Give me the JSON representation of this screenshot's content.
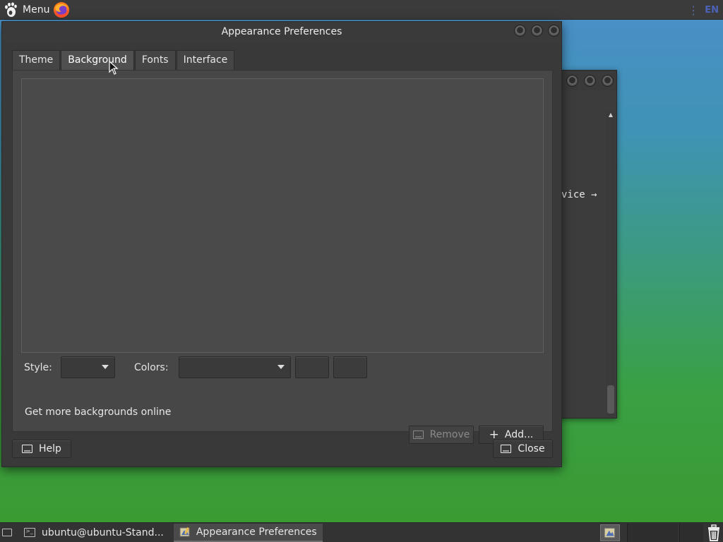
{
  "top_panel": {
    "menu_label": "Menu",
    "icons": [
      "gnome-foot-icon",
      "firefox-icon"
    ],
    "lang": "EN"
  },
  "background_window": {
    "text": "vice →"
  },
  "window": {
    "title": "Appearance Preferences",
    "tabs": [
      {
        "label": "Theme",
        "active": false
      },
      {
        "label": "Background",
        "active": true
      },
      {
        "label": "Fonts",
        "active": false
      },
      {
        "label": "Interface",
        "active": false
      }
    ],
    "style_label": "Style:",
    "style_value": "",
    "colors_label": "Colors:",
    "colors_value": "",
    "more_backgrounds": "Get more backgrounds online",
    "remove_label": "Remove",
    "add_label": "Add...",
    "help_label": "Help",
    "close_label": "Close"
  },
  "taskbar": {
    "tasks": [
      {
        "label": "ubuntu@ubuntu-Stand...",
        "active": false
      },
      {
        "label": "Appearance Preferences",
        "active": true
      }
    ]
  },
  "colors": {
    "window_bg": "#393939",
    "panel_bg": "#474747",
    "accent_lang": "#4b63b8"
  }
}
